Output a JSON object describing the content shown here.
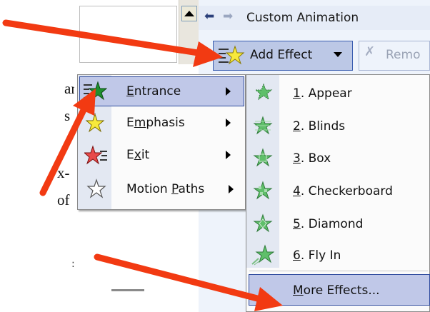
{
  "document": {
    "fragments": [
      "ar",
      "s",
      ",",
      "x-",
      "of"
    ],
    "stray_mark": ":"
  },
  "taskpane": {
    "title": "Custom Animation",
    "add_effect_label": "Add Effect",
    "remove_label": "Remo"
  },
  "menu": {
    "items": [
      {
        "label": "Entrance",
        "accel": "E",
        "rest": "ntrance"
      },
      {
        "label": "Emphasis",
        "accel": "m",
        "pre": "E",
        "rest": "phasis"
      },
      {
        "label": "Exit",
        "accel": "x",
        "pre": "E",
        "rest": "it"
      },
      {
        "label": "Motion Paths",
        "pre": "Motion ",
        "accel": "P",
        "rest": "aths"
      }
    ]
  },
  "submenu": {
    "items": [
      {
        "num": "1",
        "rest": ". Appear"
      },
      {
        "num": "2",
        "rest": ". Blinds"
      },
      {
        "num": "3",
        "rest": ". Box"
      },
      {
        "num": "4",
        "rest": ". Checkerboard"
      },
      {
        "num": "5",
        "rest": ". Diamond"
      },
      {
        "num": "6",
        "rest": ". Fly In"
      }
    ],
    "more_effects": {
      "accel": "M",
      "rest": "ore Effects..."
    }
  },
  "colors": {
    "arrow": "#f23a12",
    "selection": "#c0c8e8",
    "selection_border": "#2f4b9e"
  }
}
